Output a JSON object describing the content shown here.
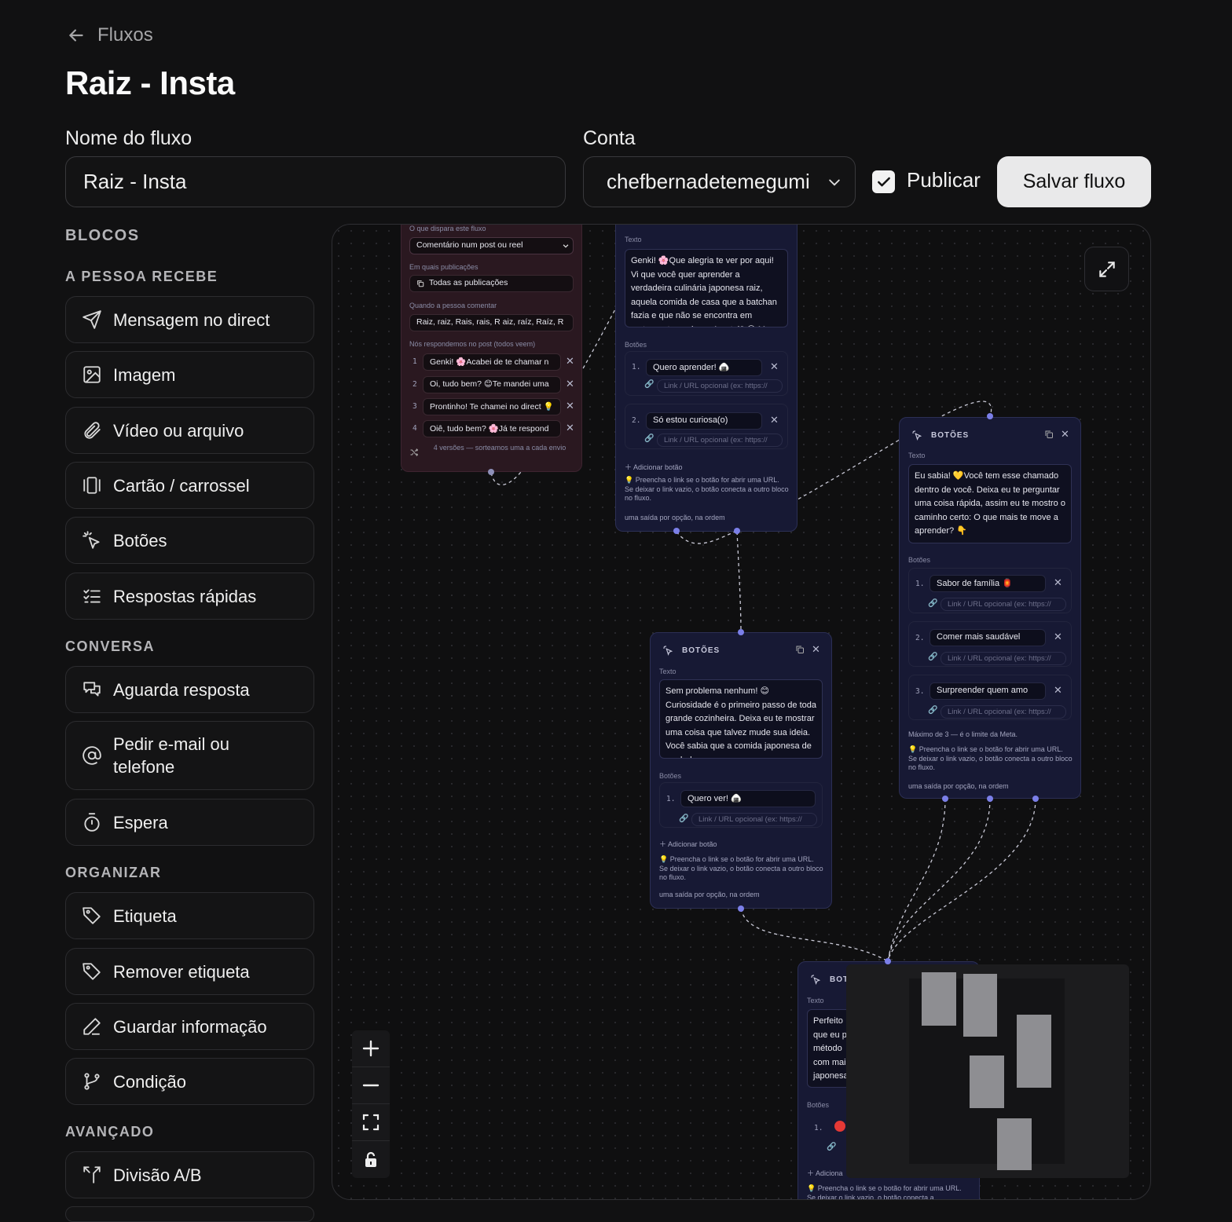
{
  "header": {
    "back_label": "Fluxos",
    "title": "Raiz - Insta"
  },
  "form": {
    "name_label": "Nome do fluxo",
    "name_value": "Raiz - Insta",
    "account_label": "Conta",
    "account_value": "chefbernadetemegumi",
    "publish_label": "Publicar",
    "publish_checked": true,
    "save_label": "Salvar fluxo"
  },
  "sidebar": {
    "blocks_title": "BLOCOS",
    "sections": {
      "receive": "A PESSOA RECEBE",
      "conversation": "CONVERSA",
      "organize": "ORGANIZAR",
      "advanced": "AVANÇADO"
    },
    "items": {
      "direct": "Mensagem no direct",
      "image": "Imagem",
      "video": "Vídeo ou arquivo",
      "card": "Cartão / carrossel",
      "buttons": "Botões",
      "quick": "Respostas rápidas",
      "await": "Aguarda resposta",
      "email": "Pedir e-mail ou telefone",
      "wait": "Espera",
      "tag": "Etiqueta",
      "remove_tag": "Remover etiqueta",
      "save_info": "Guardar informação",
      "condition": "Condição",
      "ab": "Divisão A/B"
    }
  },
  "canvas": {
    "trigger": {
      "trigger_label": "O que dispara este fluxo",
      "trigger_value": "Comentário num post ou reel",
      "posts_label": "Em quais publicações",
      "posts_value": "Todas as publicações",
      "comment_label": "Quando a pessoa comentar",
      "comment_value": "Raiz, raiz, Rais, rais, R aiz, raíz, Raíz, R",
      "reply_label": "Nós respondemos no post (todos veem)",
      "replies": [
        "Genki! 🌸Acabei de te chamar n",
        "Oi, tudo bem? 😊Te mandei uma",
        "Prontinho! Te chamei no direct 💡",
        "Oiê, tudo bem? 🌸Já te respond"
      ],
      "versions_note": "4 versões — sorteamos uma a cada envio"
    },
    "node1": {
      "text_label": "Texto",
      "text": "Genki! 🌸Que alegria te ver por aqui! Vi que você quer aprender a verdadeira culinária japonesa raiz, aquela comida de casa que a batchan fazia e que não se encontra em restaurante nenhum. Acertei? 😊 Me",
      "buttons_label": "Botões",
      "buttons": [
        "Quero aprender! 🍙",
        "Só estou curiosa(o)"
      ],
      "link_placeholder": "Link / URL opcional (ex: https://",
      "add_button": "Adicionar botão",
      "tip": "💡 Preencha o link se o botão for abrir uma URL. Se deixar o link vazio, o botão conecta a outro bloco no fluxo.",
      "output_note": "uma saída por opção, na ordem"
    },
    "node2": {
      "title": "BOTÕES",
      "text_label": "Texto",
      "text": "Sem problema nenhum! 😊 Curiosidade é o primeiro passo de toda grande cozinheira.  Deixa eu te mostrar uma coisa que talvez mude sua ideia. Você sabia que a comida japonesa de verdade, a que se",
      "buttons_label": "Botões",
      "buttons": [
        "Quero ver! 🍙"
      ],
      "link_placeholder": "Link / URL opcional (ex: https://",
      "add_button": "Adicionar botão",
      "tip": "💡 Preencha o link se o botão for abrir uma URL. Se deixar o link vazio, o botão conecta a outro bloco no fluxo.",
      "output_note": "uma saída por opção, na ordem"
    },
    "node3": {
      "title": "BOTÕES",
      "text_label": "Texto",
      "text": "Eu sabia! 💛Você tem esse chamado dentro de você.  Deixa eu te perguntar uma coisa rápida, assim eu te mostro o caminho certo:  O que mais te move a aprender? 👇",
      "buttons_label": "Botões",
      "buttons": [
        "Sabor de família 🏮",
        "Comer mais saudável",
        "Surpreender quem amo"
      ],
      "link_placeholder": "Link / URL opcional (ex: https://",
      "max_note": "Máximo de 3 — é o limite da Meta.",
      "tip": "💡 Preencha o link se o botão for abrir uma URL. Se deixar o link vazio, o botão conecta a outro bloco no fluxo.",
      "output_note": "uma saída por opção, na ordem"
    },
    "node4": {
      "title": "BOT",
      "text_label": "Texto",
      "text_lines": [
        "Perfeito",
        "que eu p",
        "método",
        "com mai",
        "japonesa"
      ],
      "buttons_label": "Botões",
      "button_num": "1.",
      "add_button": "Adiciona",
      "tip": "💡 Preencha o link se o botão for abrir uma URL. Se deixar o link vazio, o botão conecta a"
    }
  },
  "icons": [
    "arrow-left-icon",
    "chevron-down-icon",
    "check-icon",
    "send-icon",
    "image-icon",
    "paperclip-icon",
    "carousel-icon",
    "pointer-click-icon",
    "list-check-icon",
    "chat-bubbles-icon",
    "at-icon",
    "timer-icon",
    "tag-icon",
    "pencil-icon",
    "git-branch-icon",
    "split-icon",
    "plus-icon",
    "minus-icon",
    "fit-view-icon",
    "lock-icon",
    "maximize-icon",
    "copy-icon",
    "close-icon",
    "link-icon",
    "shuffle-icon"
  ]
}
